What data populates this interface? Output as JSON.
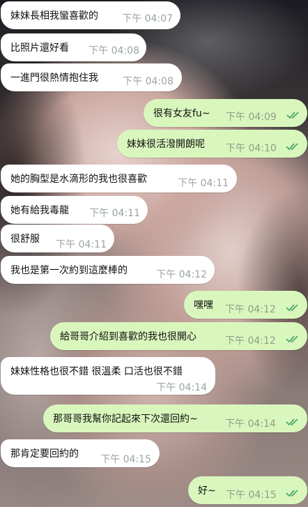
{
  "messages": [
    {
      "dir": "in",
      "text": "妹妹長相我蠻喜歡的",
      "time": "下午 04:07"
    },
    {
      "dir": "in",
      "text": "比照片還好看",
      "time": "下午 04:08"
    },
    {
      "dir": "in",
      "text": "一進門很熱情抱住我",
      "time": "下午 04:08"
    },
    {
      "dir": "out",
      "text": "很有女友fu~",
      "time": "下午 04:09",
      "status": "double-check-icon"
    },
    {
      "dir": "out",
      "text": "妹妹很活潑開朗呢",
      "time": "下午 04:10",
      "status": "double-check-icon"
    },
    {
      "dir": "in",
      "text": "她的胸型是水滴形的我也很喜歡",
      "time": "下午 04:11"
    },
    {
      "dir": "in",
      "text": "她有給我毒龍",
      "time": "下午 04:11"
    },
    {
      "dir": "in",
      "text": "很舒服",
      "time": "下午 04:11"
    },
    {
      "dir": "in",
      "text": "我也是第一次約到這麼棒的",
      "time": "下午 04:12"
    },
    {
      "dir": "out",
      "text": "嘿嘿",
      "time": "下午 04:12",
      "status": "double-check-icon"
    },
    {
      "dir": "out",
      "text": "給哥哥介紹到喜歡的我也很開心",
      "time": "下午 04:12",
      "status": "double-check-icon"
    },
    {
      "dir": "in",
      "text": "妹妹性格也很不錯 很溫柔 口活也很不錯",
      "time": "下午 04:14"
    },
    {
      "dir": "out",
      "text": "那哥哥我幫你記起來下次還回約~",
      "time": "下午 04:14",
      "status": "double-check-icon"
    },
    {
      "dir": "in",
      "text": "那肯定要回約的",
      "time": "下午 04:15"
    },
    {
      "dir": "out",
      "text": "好~",
      "time": "下午 04:15",
      "status": "double-check-icon"
    }
  ],
  "colors": {
    "incoming_bubble": "#ffffff",
    "outgoing_bubble": "#d9f7bd",
    "read_tick": "#4fa86a",
    "timestamp": "#9aa3a6"
  }
}
